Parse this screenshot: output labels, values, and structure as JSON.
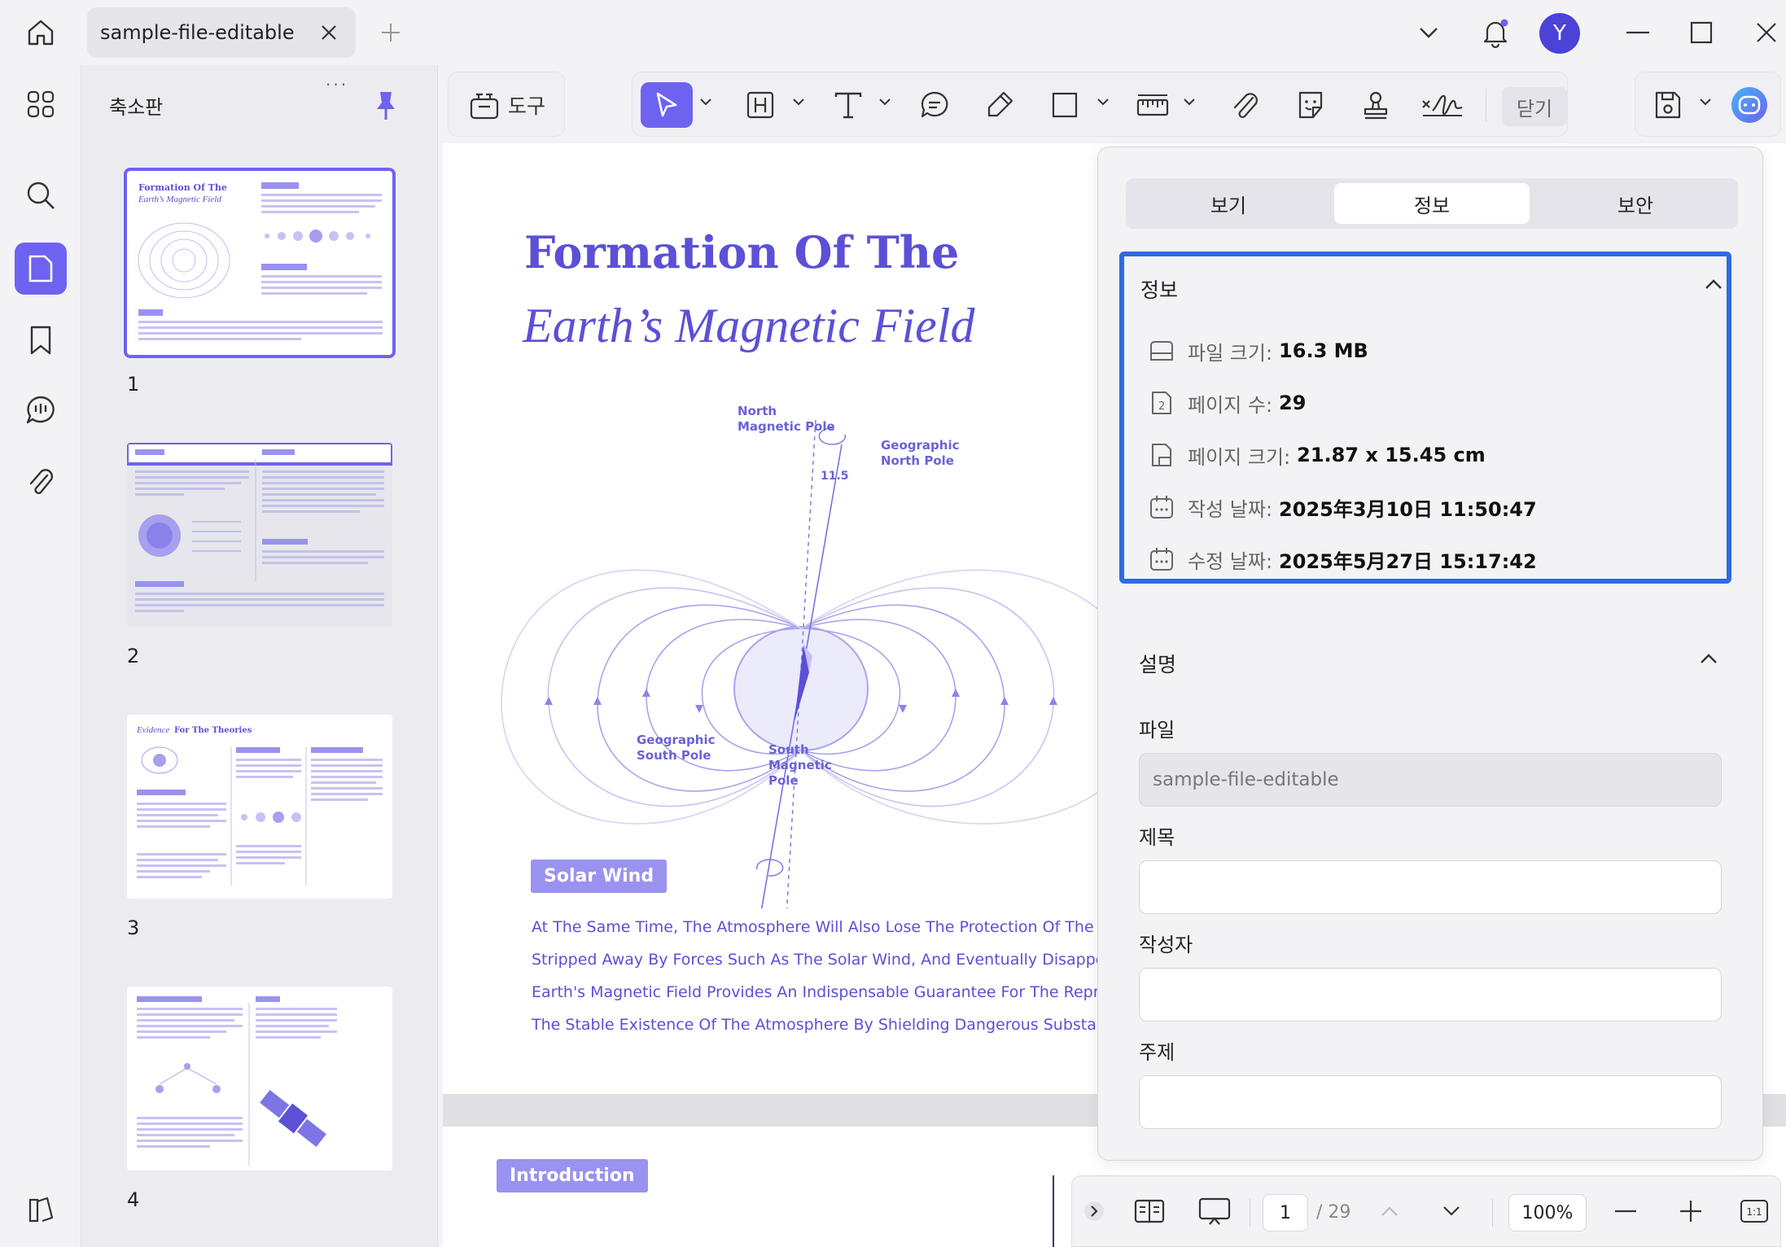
{
  "titlebar": {
    "tab_title": "sample-file-editable",
    "avatar_initial": "Y"
  },
  "thumbnails": {
    "title": "축소판",
    "handle": "...",
    "pages": [
      {
        "num": "1",
        "more": "..."
      },
      {
        "num": "2",
        "more": "..."
      },
      {
        "num": "3",
        "more": "..."
      },
      {
        "num": "4",
        "more": "..."
      }
    ]
  },
  "toolbar": {
    "tools_label": "도구",
    "close_label": "닫기"
  },
  "document": {
    "title_line1": "Formation Of The",
    "title_line2": "Earth’s Magnetic Field",
    "labels": {
      "north_mag": "North\nMagnetic Pole",
      "geo_north": "Geographic\nNorth Pole",
      "angle": "11.5",
      "geo_south": "Geographic\nSouth Pole",
      "south_mag": "South\nMagnetic\nPole"
    },
    "solar_wind_badge": "Solar Wind",
    "paragraph": [
      "At The Same Time, The Atmosphere Will Also Lose The Protection Of The Magnetic",
      "Stripped Away By Forces Such As The Solar Wind, And Eventually Disappear. It Ca",
      "Earth's Magnetic Field Provides An Indispensable Guarantee For The Reproduction",
      "The Stable Existence Of The Atmosphere By Shielding Dangerous Substances Such"
    ],
    "intro_badge": "Introduction"
  },
  "properties": {
    "tabs": [
      {
        "label": "보기"
      },
      {
        "label": "정보"
      },
      {
        "label": "보안"
      }
    ],
    "info_section_title": "정보",
    "info_rows": [
      {
        "label": "파일 크기:",
        "value": "16.3 MB"
      },
      {
        "label": "페이지 수:",
        "value": "29"
      },
      {
        "label": "페이지 크기:",
        "value": "21.87 x 15.45 cm"
      },
      {
        "label": "작성 날짜:",
        "value": "2025年3月10日 11:50:47"
      },
      {
        "label": "수정 날짜:",
        "value": "2025年5月27日 15:17:42"
      }
    ],
    "desc_section_title": "설명",
    "fields": {
      "file_label": "파일",
      "file_value": "sample-file-editable",
      "title_label": "제목",
      "author_label": "작성자",
      "subject_label": "주제"
    }
  },
  "bottombar": {
    "page_current": "1",
    "page_total": "/ 29",
    "zoom": "100%",
    "fit_label": "1:1"
  },
  "colors": {
    "accent": "#6d63f0",
    "highlight_blue": "#2e6ae3",
    "doc_purple": "#5b50d6"
  }
}
